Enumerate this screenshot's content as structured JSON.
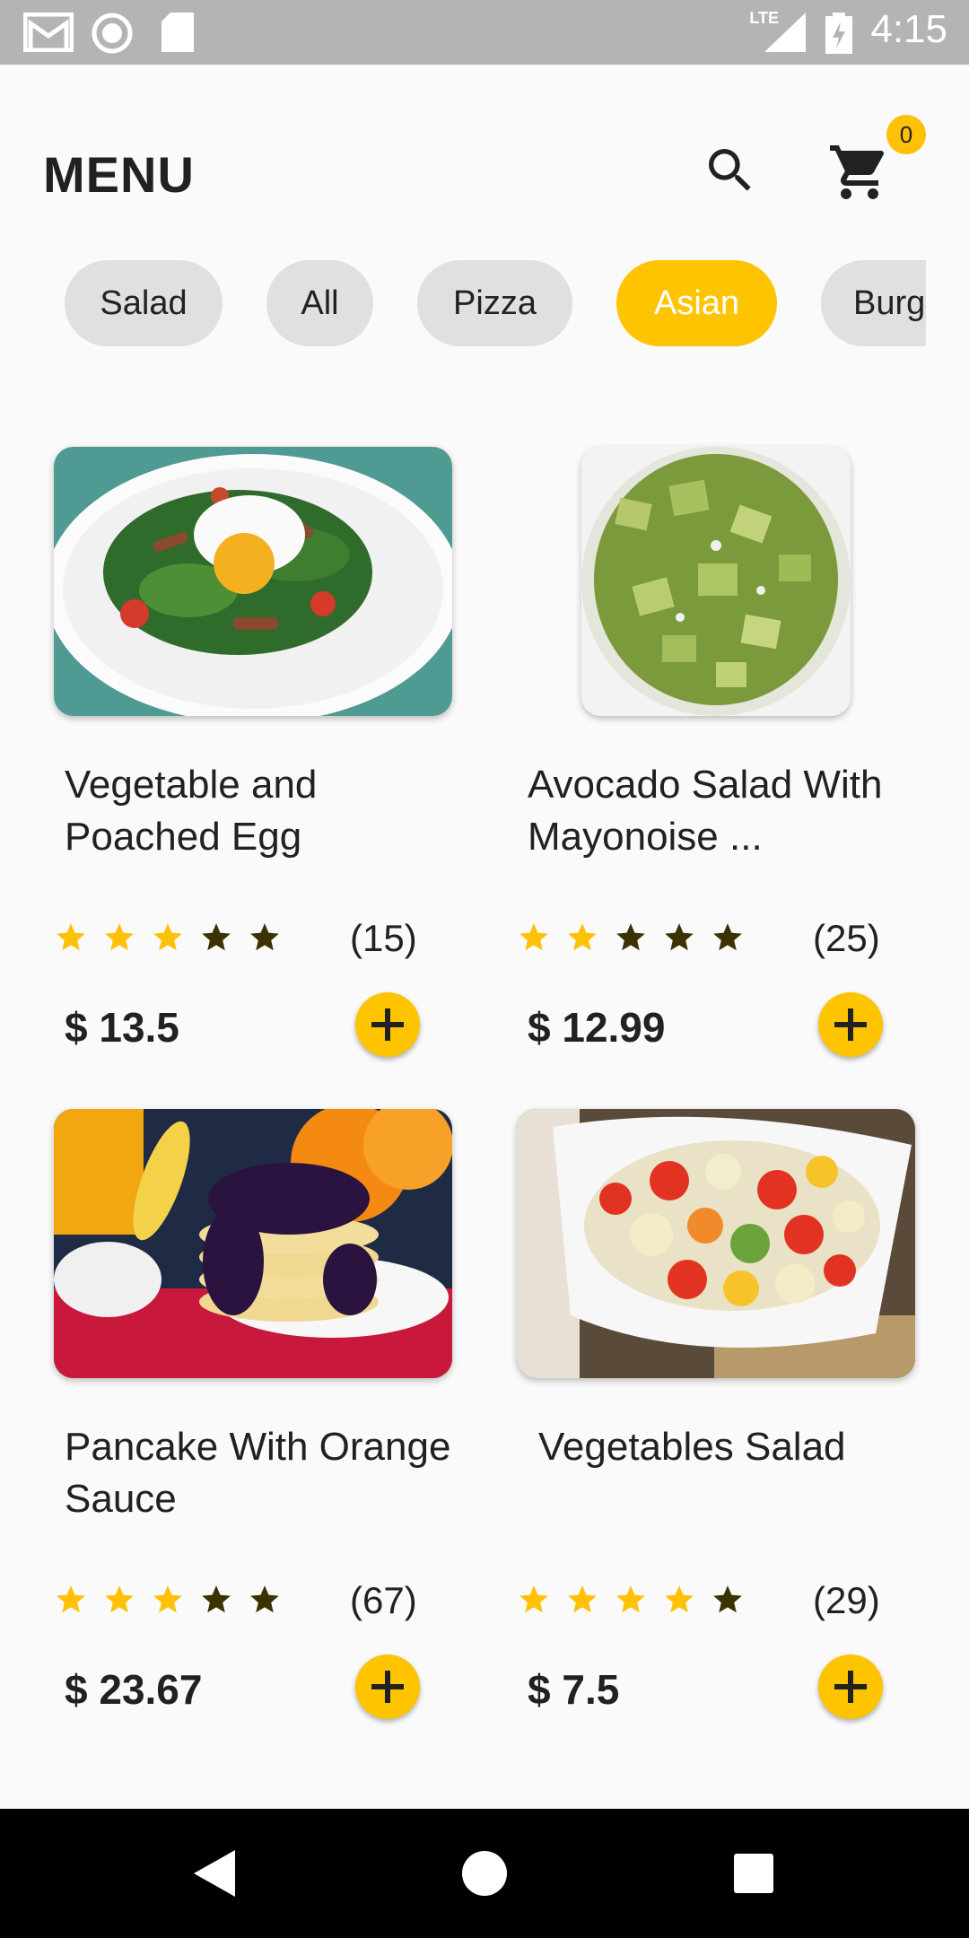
{
  "status_bar": {
    "time": "4:15",
    "network": "LTE",
    "icons": [
      "gmail-icon",
      "record-icon",
      "sd-card-icon",
      "signal-icon",
      "battery-icon"
    ]
  },
  "header": {
    "title": "MENU",
    "search_icon": "search-icon",
    "cart_icon": "cart-icon",
    "cart_count": "0"
  },
  "categories": [
    {
      "label": "Salad",
      "active": false
    },
    {
      "label": "All",
      "active": false
    },
    {
      "label": "Pizza",
      "active": false
    },
    {
      "label": "Asian",
      "active": true
    },
    {
      "label": "Burg",
      "active": false
    }
  ],
  "products": [
    {
      "title": "Vegetable and Poached Egg",
      "rating": 3,
      "reviews": "(15)",
      "price": "$ 13.5"
    },
    {
      "title": "Avocado Salad With Mayonoise ...",
      "rating": 2,
      "reviews": "(25)",
      "price": "$ 12.99"
    },
    {
      "title": "Pancake With Orange Sauce",
      "rating": 3,
      "reviews": "(67)",
      "price": "$ 23.67"
    },
    {
      "title": "Vegetables Salad",
      "rating": 4,
      "reviews": "(29)",
      "price": "$ 7.5"
    }
  ],
  "colors": {
    "accent": "#ffc400",
    "star_filled": "#ffc107",
    "star_empty": "#3a3200",
    "chip_bg": "#e0e0e0"
  },
  "nav": [
    "back-icon",
    "home-icon",
    "recents-icon"
  ]
}
